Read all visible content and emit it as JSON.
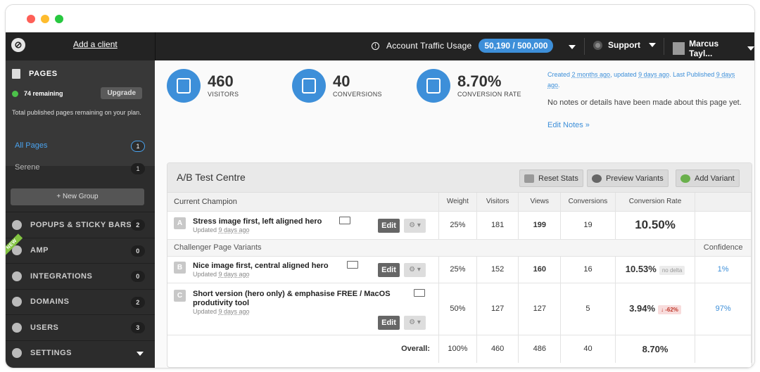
{
  "topbar": {
    "add_client": "Add a client",
    "traffic_label": "Account Traffic Usage",
    "traffic_value": "50,190 / 500,000",
    "support": "Support",
    "user": "Marcus Tayl..."
  },
  "sidebar": {
    "pages_title": "PAGES",
    "remaining": "74 remaining",
    "upgrade": "Upgrade",
    "plan_note": "Total published pages remaining on your plan.",
    "all_pages": "All Pages",
    "all_pages_count": "1",
    "serene": "Serene",
    "serene_count": "1",
    "new_group": "+ New Group",
    "nav": [
      {
        "label": "POPUPS & STICKY BARS",
        "count": "2"
      },
      {
        "label": "AMP",
        "count": "0",
        "ribbon": "NEW"
      },
      {
        "label": "INTEGRATIONS",
        "count": "0"
      },
      {
        "label": "DOMAINS",
        "count": "2"
      },
      {
        "label": "USERS",
        "count": "3"
      },
      {
        "label": "SETTINGS"
      }
    ]
  },
  "stats": {
    "visitors": {
      "value": "460",
      "label": "VISITORS"
    },
    "conversions": {
      "value": "40",
      "label": "CONVERSIONS"
    },
    "rate": {
      "value": "8.70%",
      "label": "CONVERSION RATE"
    }
  },
  "meta": {
    "created_prefix": "Created ",
    "created": "2 months ago",
    "updated_prefix": ", updated ",
    "updated": "9 days ago",
    "published_prefix": ". Last Published ",
    "published": "9 days ago",
    "suffix": ".",
    "notes": "No notes or details have been made about this page yet.",
    "edit_notes": "Edit Notes »"
  },
  "ab": {
    "title": "A/B Test Centre",
    "reset": "Reset Stats",
    "preview": "Preview Variants",
    "add": "Add Variant",
    "headers": {
      "champion": "Current Champion",
      "weight": "Weight",
      "visitors": "Visitors",
      "views": "Views",
      "conversions": "Conversions",
      "rate": "Conversion Rate"
    },
    "challenger_label": "Challenger Page Variants",
    "confidence_label": "Confidence",
    "edit": "Edit",
    "gear": "⚙ ▾",
    "variants": [
      {
        "letter": "A",
        "name": "Stress image first, left aligned hero",
        "updated_prefix": "Updated ",
        "updated": "9 days ago",
        "weight": "25%",
        "visitors": "181",
        "views": "199",
        "conversions": "19",
        "rate": "10.50%"
      },
      {
        "letter": "B",
        "name": "Nice image first, central aligned hero",
        "updated_prefix": "Updated ",
        "updated": "9 days ago",
        "weight": "25%",
        "visitors": "152",
        "views": "160",
        "conversions": "16",
        "rate": "10.53%",
        "delta": "no delta",
        "confidence": "1%"
      },
      {
        "letter": "C",
        "name": "Short version (hero only) & emphasise FREE / MacOS produtivity tool",
        "updated_prefix": "Updated ",
        "updated": "9 days ago",
        "weight": "50%",
        "visitors": "127",
        "views": "127",
        "conversions": "5",
        "rate": "3.94%",
        "delta": "↓ -62%",
        "confidence": "97%"
      }
    ],
    "overall": {
      "label": "Overall:",
      "weight": "100%",
      "visitors": "460",
      "views": "486",
      "conversions": "40",
      "rate": "8.70%"
    }
  }
}
